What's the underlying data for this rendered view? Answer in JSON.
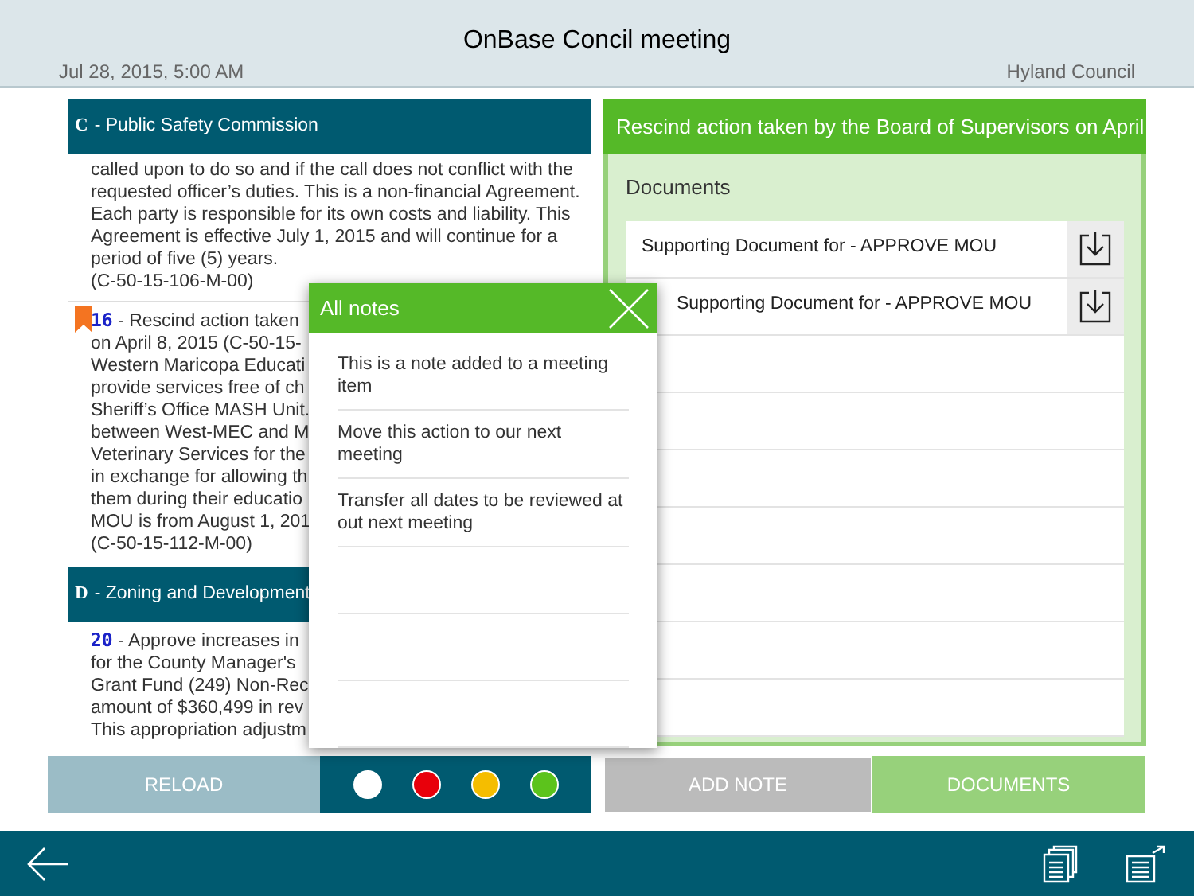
{
  "header": {
    "title": "OnBase Concil meeting",
    "date": "Jul 28, 2015, 5:00 AM",
    "council": "Hyland Council"
  },
  "agenda": [
    {
      "letter": "C",
      "title": "- Public Safety Commission",
      "items": [
        {
          "bookmarked": false,
          "lines": [
            "called upon to do so and if the call does not conflict with the",
            "requested officer’s duties. This is a non-financial Agreement.",
            "Each party is responsible for its own costs and liability. This",
            "Agreement is effective July 1, 2015 and will continue for a",
            "period of five (5) years.",
            "(C-50-15-106-M-00)"
          ]
        },
        {
          "number": "16",
          "bookmarked": true,
          "lines": [
            "- Rescind action taken",
            "on April 8, 2015 (C-50-15-",
            "Western Maricopa Educati",
            "provide services free of ch",
            "Sheriff’s Office MASH Unit.",
            "between West-MEC and M",
            "Veterinary Services for the",
            "in exchange for allowing th",
            "them during their educatio",
            "MOU is from August 1, 201",
            "(C-50-15-112-M-00)"
          ]
        }
      ]
    },
    {
      "letter": "D",
      "title": "- Zoning and Development",
      "items": [
        {
          "number": "20",
          "bookmarked": false,
          "lines": [
            "- Approve increases in",
            "for the County Manager's",
            "Grant Fund (249) Non-Rec",
            "amount of $360,499 in rev",
            "This appropriation adjustm"
          ]
        }
      ]
    }
  ],
  "detail": {
    "title": "Rescind action taken by the Board of Supervisors on April",
    "documents_label": "Documents",
    "documents": [
      "Supporting Document for - APPROVE MOU",
      "Supporting Document for - APPROVE MOU"
    ]
  },
  "notes_popup": {
    "title": "All notes",
    "notes": [
      "This is a note added to a meeting item",
      "Move this action to our next meeting",
      "Transfer all dates to be reviewed at out next meeting"
    ]
  },
  "actions": {
    "reload": "RELOAD",
    "colors": [
      {
        "color": "#ffffff"
      },
      {
        "color": "#e8000b"
      },
      {
        "color": "#f5bd00"
      },
      {
        "color": "#5cc31c"
      }
    ],
    "add_note": "ADD NOTE",
    "documents": "DOCUMENTS"
  }
}
